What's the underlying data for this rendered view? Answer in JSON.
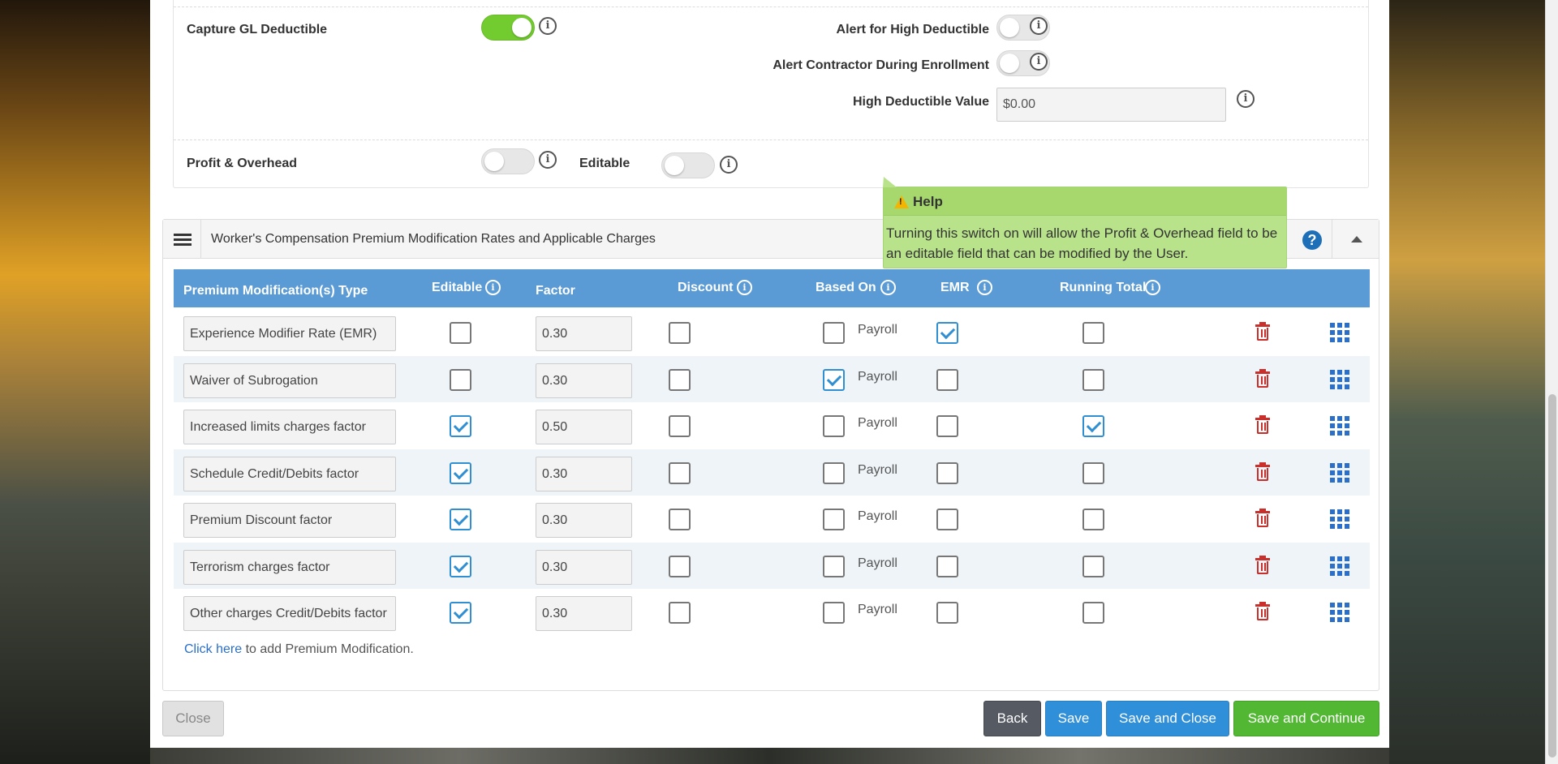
{
  "gl_section": {
    "capture_gl_label": "Capture GL Deductible",
    "capture_gl_on": true,
    "alert_high_label": "Alert for High Deductible",
    "alert_high_on": false,
    "alert_contractor_label": "Alert Contractor During Enrollment",
    "alert_contractor_on": false,
    "high_value_label": "High Deductible Value",
    "high_value": "$0.00",
    "profit_label": "Profit & Overhead",
    "profit_on": false,
    "editable_label": "Editable",
    "editable_on": false
  },
  "info_glyph": "i",
  "tooltip": {
    "title": "Help",
    "body": "Turning this switch on will allow the Profit & Overhead field to be an editable field that can be modified by the User."
  },
  "wc_panel": {
    "title": "Worker's Compensation Premium Modification Rates and Applicable Charges",
    "help_glyph": "?",
    "columns": {
      "type": "Premium Modification(s) Type",
      "editable": "Editable",
      "factor": "Factor",
      "discount": "Discount",
      "based_on": "Based On",
      "emr": "EMR",
      "running_total": "Running Total"
    },
    "rows": [
      {
        "type": "Experience Modifier Rate (EMR)",
        "editable": false,
        "factor": "0.30",
        "discount": false,
        "based_on_checked": false,
        "based_on_label": "Payroll",
        "emr": true,
        "running_total": false
      },
      {
        "type": "Waiver of Subrogation",
        "editable": false,
        "factor": "0.30",
        "discount": false,
        "based_on_checked": true,
        "based_on_label": "Payroll",
        "emr": false,
        "running_total": false
      },
      {
        "type": "Increased limits charges factor",
        "editable": true,
        "factor": "0.50",
        "discount": false,
        "based_on_checked": false,
        "based_on_label": "Payroll",
        "emr": false,
        "running_total": true
      },
      {
        "type": "Schedule Credit/Debits factor",
        "editable": true,
        "factor": "0.30",
        "discount": false,
        "based_on_checked": false,
        "based_on_label": "Payroll",
        "emr": false,
        "running_total": false
      },
      {
        "type": "Premium Discount factor",
        "editable": true,
        "factor": "0.30",
        "discount": false,
        "based_on_checked": false,
        "based_on_label": "Payroll",
        "emr": false,
        "running_total": false
      },
      {
        "type": "Terrorism charges factor",
        "editable": true,
        "factor": "0.30",
        "discount": false,
        "based_on_checked": false,
        "based_on_label": "Payroll",
        "emr": false,
        "running_total": false
      },
      {
        "type": "Other charges Credit/Debits factor",
        "editable": true,
        "factor": "0.30",
        "discount": false,
        "based_on_checked": false,
        "based_on_label": "Payroll",
        "emr": false,
        "running_total": false
      }
    ],
    "add_link": "Click here",
    "add_text": " to add Premium Modification."
  },
  "footer": {
    "close": "Close",
    "back": "Back",
    "save": "Save",
    "save_close": "Save and Close",
    "save_continue": "Save and Continue"
  }
}
